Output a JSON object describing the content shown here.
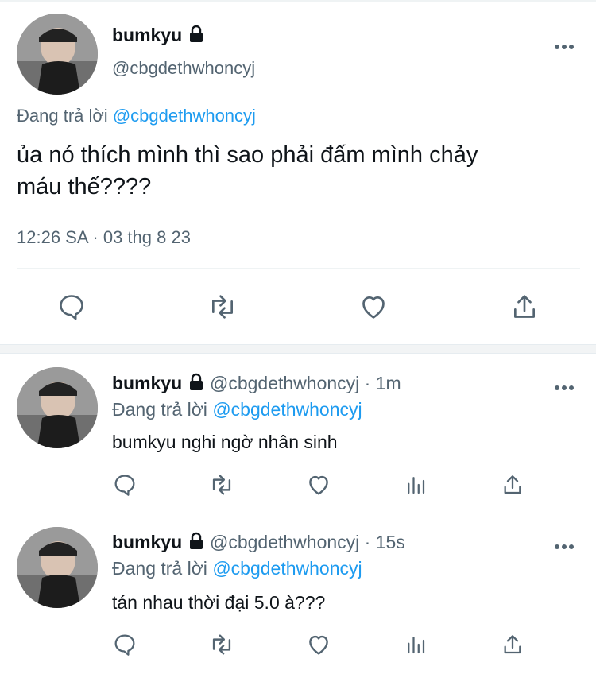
{
  "main_tweet": {
    "display_name": "bumkyu",
    "handle": "@cbgdethwhoncyj",
    "reply_prefix": "Đang trả lời",
    "reply_to": "@cbgdethwhoncyj",
    "text_line1": "ủa nó thích mình thì sao phải đấm mình chảy",
    "text_line2": "máu thế????",
    "timestamp": "12:26 SA · 03 thg 8 23",
    "actions": [
      "reply-icon",
      "retweet-icon",
      "like-icon",
      "share-icon"
    ]
  },
  "replies": [
    {
      "display_name": "bumkyu",
      "handle_time": "@cbgdethwhoncyj · 1m",
      "reply_prefix": "Đang trả lời",
      "reply_to": "@cbgdethwhoncyj",
      "text": "bumkyu nghi ngờ nhân sinh"
    },
    {
      "display_name": "bumkyu",
      "handle_time": "@cbgdethwhoncyj · 15s",
      "reply_prefix": "Đang trả lời",
      "reply_to": "@cbgdethwhoncyj",
      "text": "tán nhau thời đại 5.0 à???"
    }
  ],
  "colors": {
    "text": "#0f1419",
    "muted": "#536471",
    "link": "#1d9bf0",
    "divider": "#eff3f4"
  }
}
